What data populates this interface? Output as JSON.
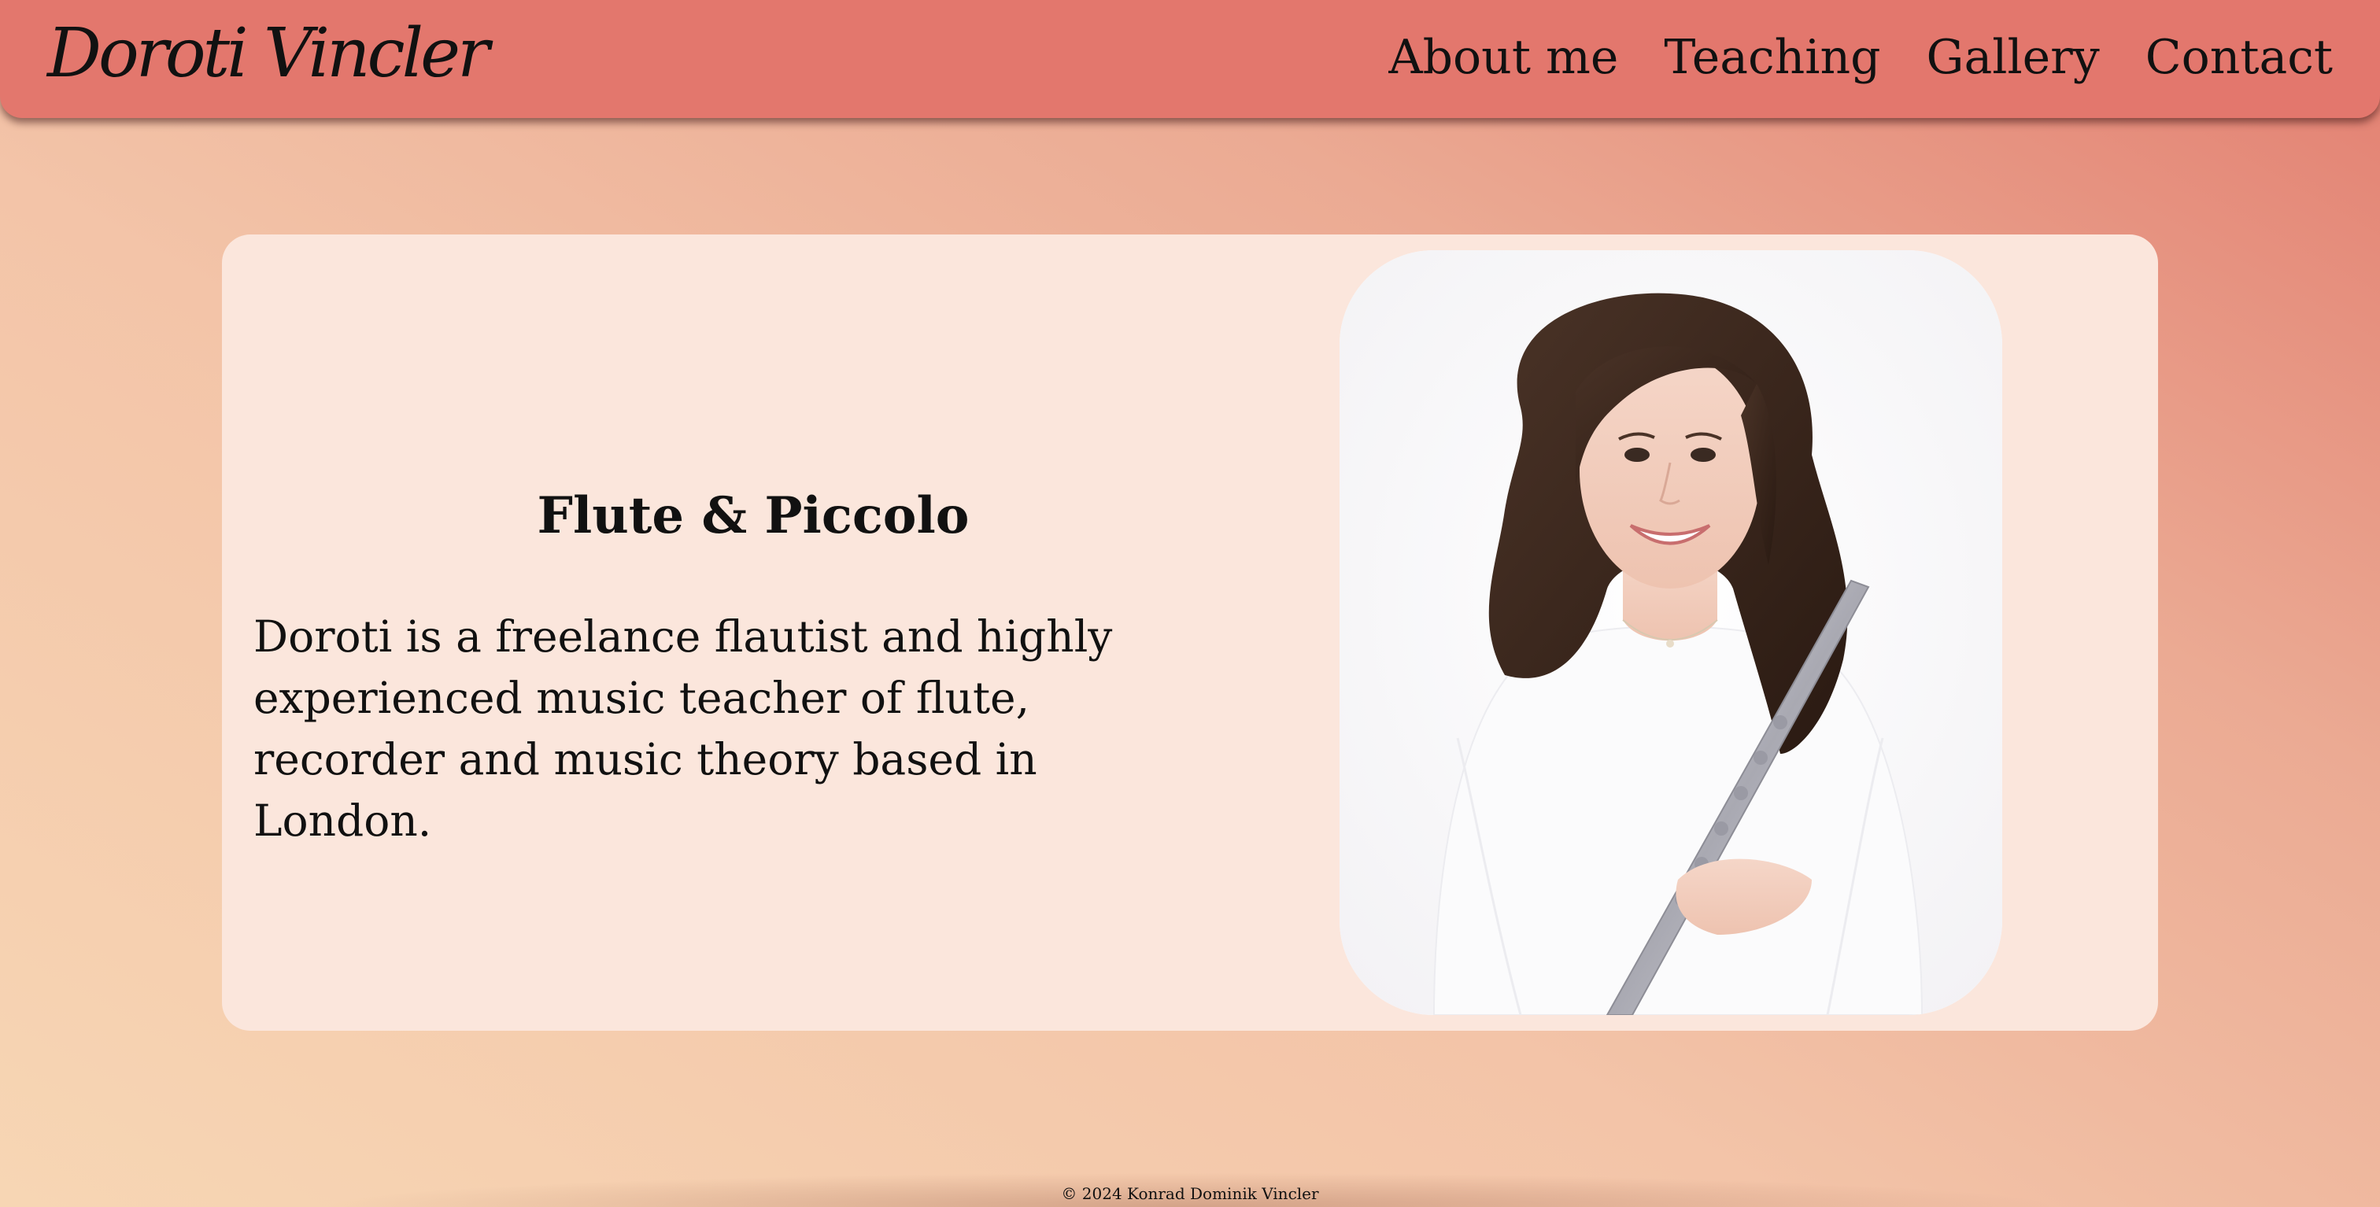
{
  "header": {
    "logo": "Doroti Vincler",
    "nav": [
      {
        "label": "About me"
      },
      {
        "label": "Teaching"
      },
      {
        "label": "Gallery"
      },
      {
        "label": "Contact"
      }
    ]
  },
  "hero": {
    "title": "Flute & Piccolo",
    "description": "Doroti is a freelance flautist and highly experienced music teacher of flute, recorder and music theory based in London."
  },
  "footer": {
    "text": "© 2024 Konrad Dominik Vincler"
  },
  "colors": {
    "header": "#e3776d",
    "card": "#fbe6dc",
    "bg_light": "#f7d6b4",
    "bg_dark": "#e27e70"
  }
}
